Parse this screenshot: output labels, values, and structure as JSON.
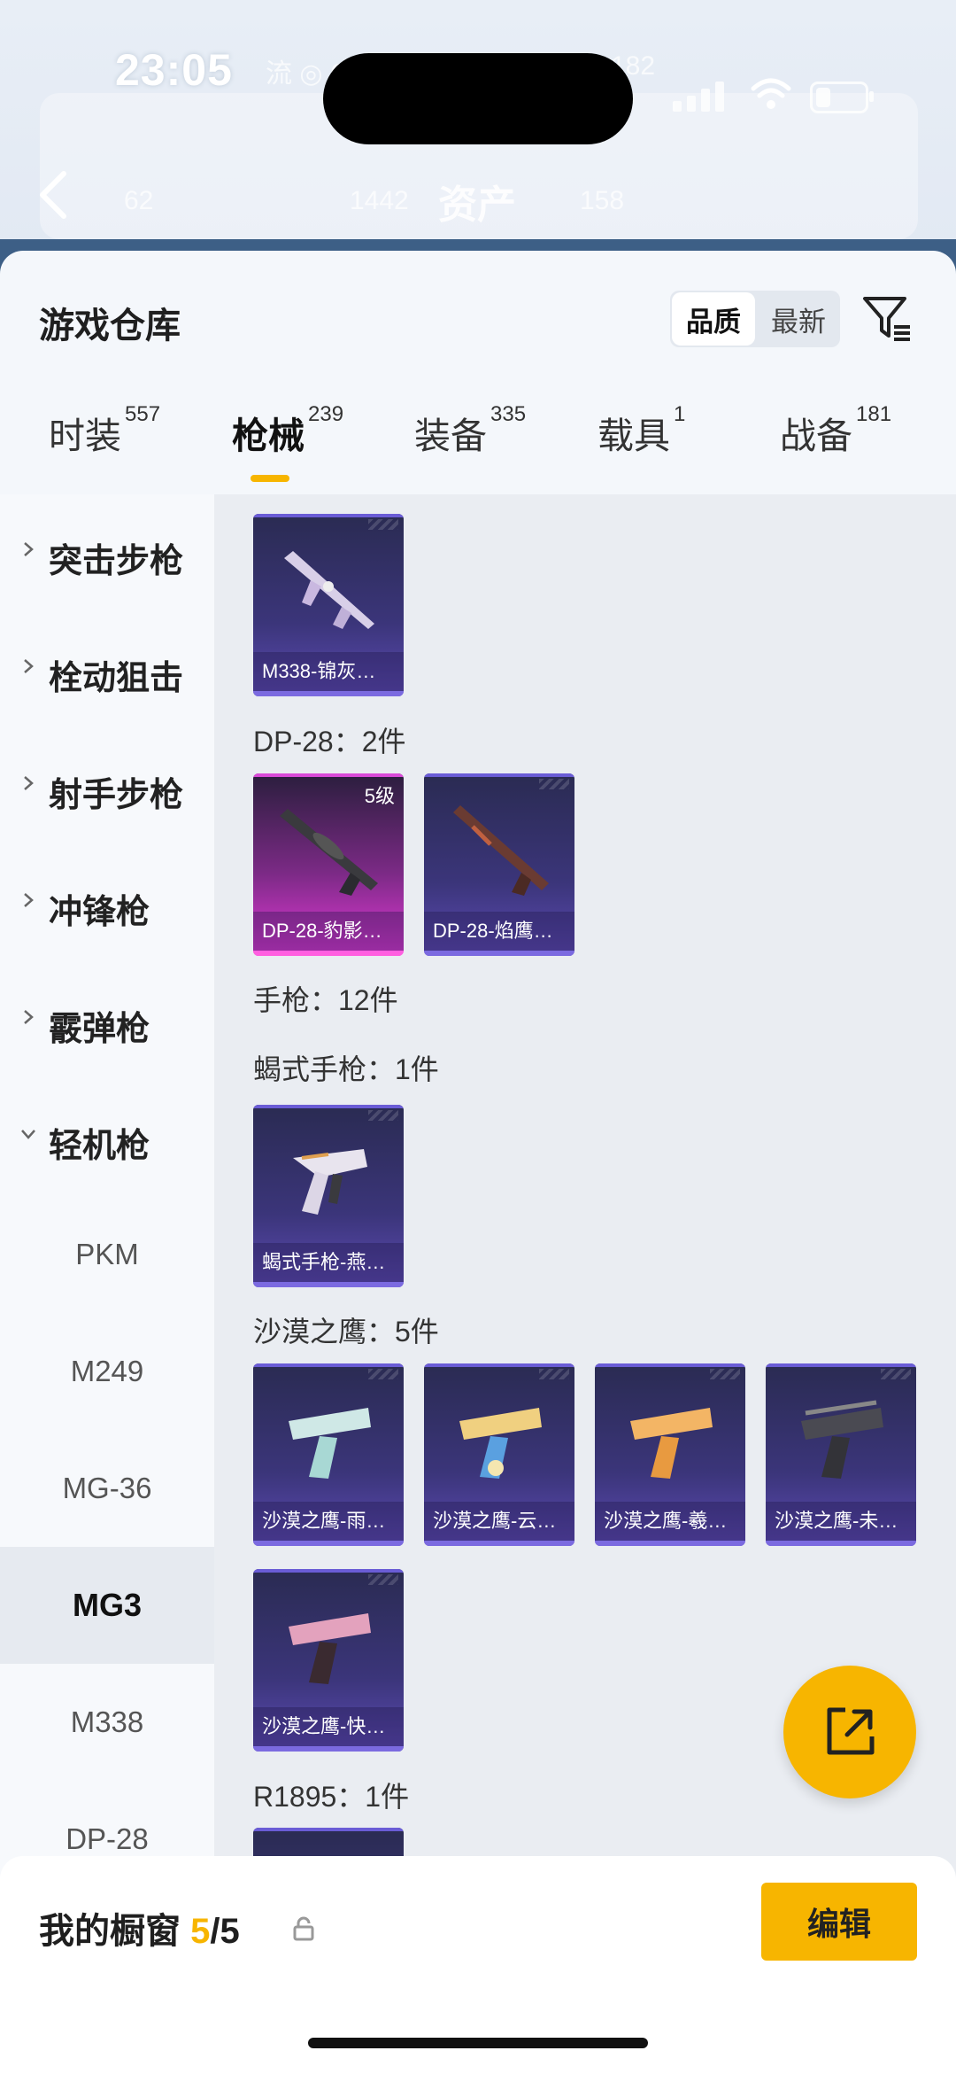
{
  "status": {
    "time": "23:05",
    "ghost_left": "流 ◎ 62K",
    "ghost_right": "182"
  },
  "background": {
    "title": "资产",
    "stats": [
      "62",
      "1442",
      "158"
    ]
  },
  "sheet": {
    "title": "游戏仓库",
    "sort": {
      "quality": "品质",
      "newest": "最新"
    }
  },
  "tabs": [
    {
      "label": "时装",
      "count": "557"
    },
    {
      "label": "枪械",
      "count": "239"
    },
    {
      "label": "装备",
      "count": "335"
    },
    {
      "label": "载具",
      "count": "1"
    },
    {
      "label": "战备",
      "count": "181"
    }
  ],
  "categories": [
    {
      "label": "突击步枪"
    },
    {
      "label": "栓动狙击"
    },
    {
      "label": "射手步枪"
    },
    {
      "label": "冲锋枪"
    },
    {
      "label": "霰弹枪"
    },
    {
      "label": "轻机枪"
    }
  ],
  "subcategories": [
    "PKM",
    "M249",
    "MG-36",
    "MG3",
    "M338",
    "DP-28"
  ],
  "content": {
    "cards_m338": [
      "M338-锦灰…"
    ],
    "group_dp28": "DP-28：2件",
    "cards_dp28": [
      {
        "name": "DP-28-豹影…",
        "level": "5级"
      },
      {
        "name": "DP-28-焰鹰…"
      }
    ],
    "group_pistol": "手枪：12件",
    "group_scorpion": "蝎式手枪：1件",
    "cards_scorpion": [
      "蝎式手枪-燕…"
    ],
    "group_deagle": "沙漠之鹰：5件",
    "cards_deagle": [
      "沙漠之鹰-雨…",
      "沙漠之鹰-云…",
      "沙漠之鹰-羲…",
      "沙漠之鹰-未…",
      "沙漠之鹰-快…"
    ],
    "group_r1895": "R1895：1件"
  },
  "bottom": {
    "showcase_label": "我的橱窗",
    "current": "5",
    "total": "/5",
    "edit": "编辑"
  },
  "colors": {
    "accent": "#f7b500",
    "card_purple": "#3b357a",
    "card_pink": "#e43ad8"
  }
}
